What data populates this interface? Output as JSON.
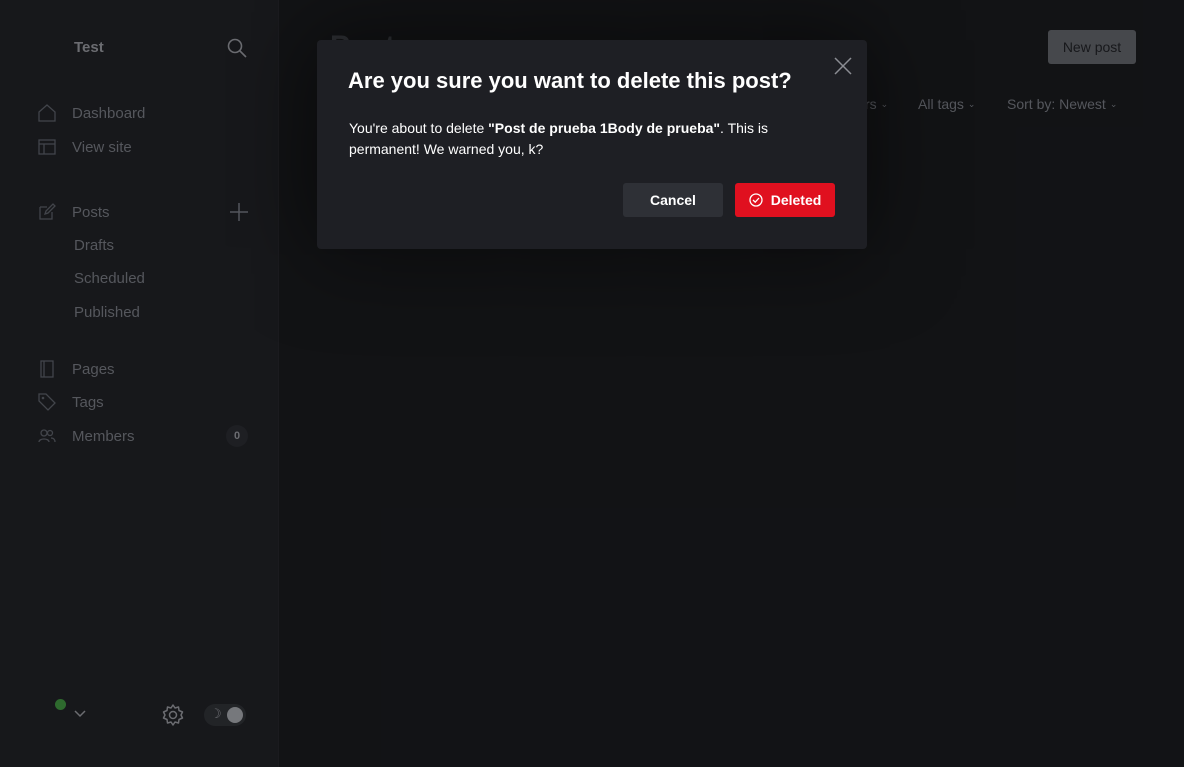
{
  "sidebar": {
    "site_title": "Test",
    "nav": {
      "dashboard": "Dashboard",
      "view_site": "View site",
      "posts": "Posts",
      "drafts": "Drafts",
      "scheduled": "Scheduled",
      "published": "Published",
      "pages": "Pages",
      "tags": "Tags",
      "members": "Members",
      "members_count": "0"
    },
    "theme_toggle_moon": "☽"
  },
  "main": {
    "page_title": "Posts",
    "new_post_label": "New post",
    "filters": {
      "members": "rs",
      "tags": "All tags",
      "sort": "Sort by: Newest"
    }
  },
  "modal": {
    "title": "Are you sure you want to delete this post?",
    "body_prefix": "You're about to delete ",
    "post_name": "\"Post de prueba 1Body de prueba\"",
    "body_suffix": ". This is permanent! We warned you, k?",
    "cancel_label": "Cancel",
    "delete_label": "Deleted"
  },
  "colors": {
    "background": "#151619",
    "sidebar": "#1b1c20",
    "modal": "#1e1f24",
    "danger": "#e0101f",
    "status_online": "#3a8a3a"
  }
}
